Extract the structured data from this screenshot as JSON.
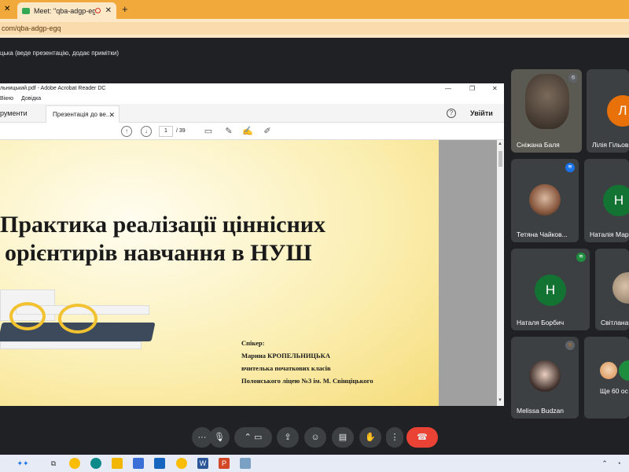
{
  "browser": {
    "active_tab_title": "Meet: \"qba-adgp-egq\"",
    "url": "com/qba-adgp-egq"
  },
  "meet": {
    "presenter_text": "цька (веде презентацію, додає примітки)"
  },
  "acrobat": {
    "window_title": "льницький.pdf - Adobe Acrobat Reader DC",
    "menu": [
      "Вікно",
      "Довідка"
    ],
    "tab_tools": "рументи",
    "tab_doc": "Презентація до ве...",
    "sign_in": "Увійти",
    "page_current": "1",
    "page_total": "/ 39"
  },
  "slide": {
    "title_line1": "Практика реалізації ціннісних",
    "title_line2": "орієнтирів навчання в НУШ",
    "speaker_label": "Спікер:",
    "speaker_name": "Марина КРОПЕЛЬНИЦЬКА",
    "speaker_role": "вчителька початкових класів",
    "speaker_school": "Полонського ліцею №3 ім. М. Свінціцького"
  },
  "participants": [
    {
      "name": "Сніжана Баля",
      "type": "video"
    },
    {
      "name": "Лілія Гільов",
      "type": "letter",
      "letter": "Л",
      "color": "#e8710a"
    },
    {
      "name": "Тетяна Чайков...",
      "type": "photo"
    },
    {
      "name": "Наталія Мар",
      "type": "letter",
      "letter": "Н",
      "color": "#137333"
    },
    {
      "name": "Наталя Борбич",
      "type": "letter",
      "letter": "Н",
      "color": "#137333"
    },
    {
      "name": "Світлана",
      "type": "photo"
    },
    {
      "name": "Melissa Budzan",
      "type": "photo"
    },
    {
      "name": "Ще 60 ос",
      "type": "more"
    }
  ],
  "colors": {
    "tab_bar": "#f2a93b",
    "end_call": "#ea4335",
    "meet_bg": "#202124"
  }
}
